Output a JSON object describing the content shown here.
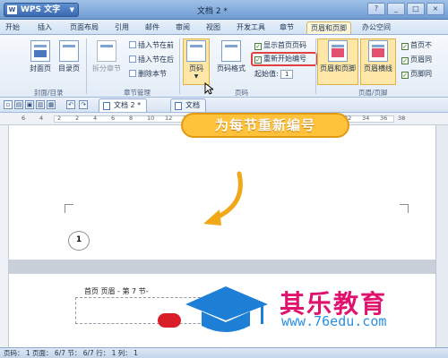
{
  "titlebar": {
    "app_name": "WPS 文字",
    "logo": "W",
    "doc_title": "文档 2 *",
    "controls": [
      "?",
      "_",
      "□",
      "×"
    ]
  },
  "menu": {
    "tabs": [
      "开始",
      "插入",
      "页面布局",
      "引用",
      "邮件",
      "审阅",
      "视图",
      "开发工具",
      "章节",
      "页眉和页脚",
      "办公空间"
    ],
    "active": "页眉和页脚"
  },
  "ribbon": {
    "cover_page": "封面页",
    "toc_page": "目录页",
    "split_chapter": "拆分章节",
    "insert_before": "插入节在前",
    "insert_after": "插入节在后",
    "delete_section": "删除本节",
    "page_number": "页码",
    "page_number_format": "页码格式",
    "show_first_page": "显示首页页码",
    "restart_numbering": "重新开始编号",
    "start_value_label": "起始值:",
    "start_value": "1",
    "header_footer": "页眉和页脚",
    "header_line": "页眉横线",
    "first_page_diff": "首页不",
    "header_same": "页眉同",
    "footer_same": "页脚同",
    "group_cover_toc": "封面/目录",
    "group_section_mgmt": "章节管理",
    "group_page_number": "页码",
    "group_header_footer": "页眉/页脚"
  },
  "docbar": {
    "tab1": "文档 2 *",
    "tab2": "文档"
  },
  "ruler_numbers": [
    "6",
    "4",
    "2",
    "2",
    "4",
    "6",
    "8",
    "10",
    "12",
    "14",
    "16",
    "18",
    "20",
    "22",
    "24",
    "26",
    "28",
    "30",
    "32",
    "34",
    "36",
    "38"
  ],
  "callout": "为每节重新编号",
  "page": {
    "page_number": "1",
    "header_label": "首页 页眉 - 第 7 节-"
  },
  "watermark": {
    "name": "其乐教育",
    "url": "www.76edu.com"
  },
  "status": {
    "text": "页码： 1  页面： 6/7  节： 6/7  行： 1  列： 1"
  }
}
